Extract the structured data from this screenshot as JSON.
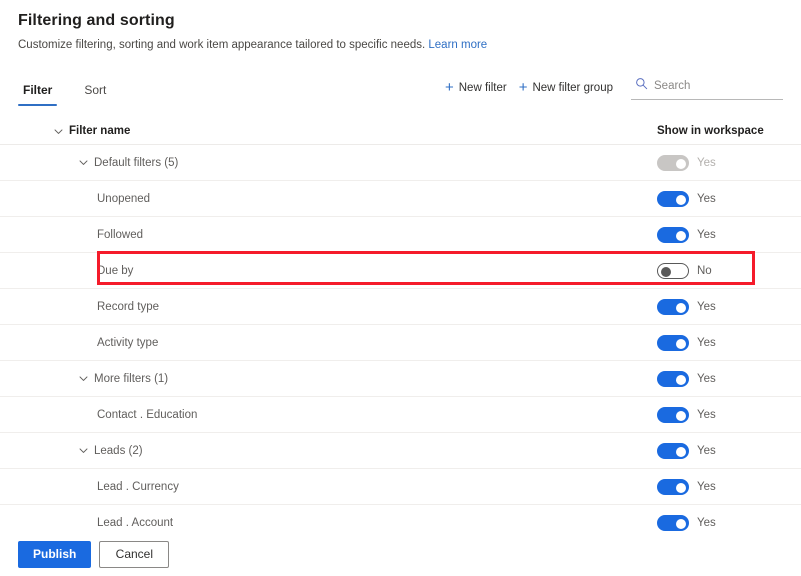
{
  "header": {
    "title": "Filtering and sorting",
    "subtitle": "Customize filtering, sorting and work item appearance tailored to specific needs.",
    "learn_more": "Learn more"
  },
  "tabs": [
    {
      "label": "Filter",
      "active": true
    },
    {
      "label": "Sort",
      "active": false
    }
  ],
  "commands": {
    "new_filter": "New filter",
    "new_filter_group": "New filter group",
    "plus_icon": "plus-icon",
    "search_icon": "search-icon",
    "search_placeholder": "Search",
    "search_value": ""
  },
  "grid": {
    "columns": {
      "name": "Filter name",
      "toggle": "Show in workspace"
    },
    "rows": [
      {
        "label": "Default filters (5)",
        "indent": 1,
        "chevron": true,
        "toggle": "Yes",
        "state": "disabled"
      },
      {
        "label": "Unopened",
        "indent": 2,
        "chevron": false,
        "toggle": "Yes",
        "state": "on"
      },
      {
        "label": "Followed",
        "indent": 2,
        "chevron": false,
        "toggle": "Yes",
        "state": "on"
      },
      {
        "label": "Due by",
        "indent": 2,
        "chevron": false,
        "toggle": "No",
        "state": "off",
        "highlighted": true
      },
      {
        "label": "Record type",
        "indent": 2,
        "chevron": false,
        "toggle": "Yes",
        "state": "on"
      },
      {
        "label": "Activity type",
        "indent": 2,
        "chevron": false,
        "toggle": "Yes",
        "state": "on"
      },
      {
        "label": "More filters (1)",
        "indent": 1,
        "chevron": true,
        "toggle": "Yes",
        "state": "on"
      },
      {
        "label": "Contact . Education",
        "indent": 2,
        "chevron": false,
        "toggle": "Yes",
        "state": "on"
      },
      {
        "label": "Leads (2)",
        "indent": 1,
        "chevron": true,
        "toggle": "Yes",
        "state": "on"
      },
      {
        "label": "Lead . Currency",
        "indent": 2,
        "chevron": false,
        "toggle": "Yes",
        "state": "on"
      },
      {
        "label": "Lead . Account",
        "indent": 2,
        "chevron": false,
        "toggle": "Yes",
        "state": "on"
      }
    ]
  },
  "footer": {
    "publish": "Publish",
    "cancel": "Cancel"
  },
  "colors": {
    "accent": "#1a6ae0",
    "link": "#2f6fc4",
    "highlight": "#f51b2a",
    "toggle_off_border": "#595959",
    "toggle_disabled": "#c8c6c4"
  }
}
